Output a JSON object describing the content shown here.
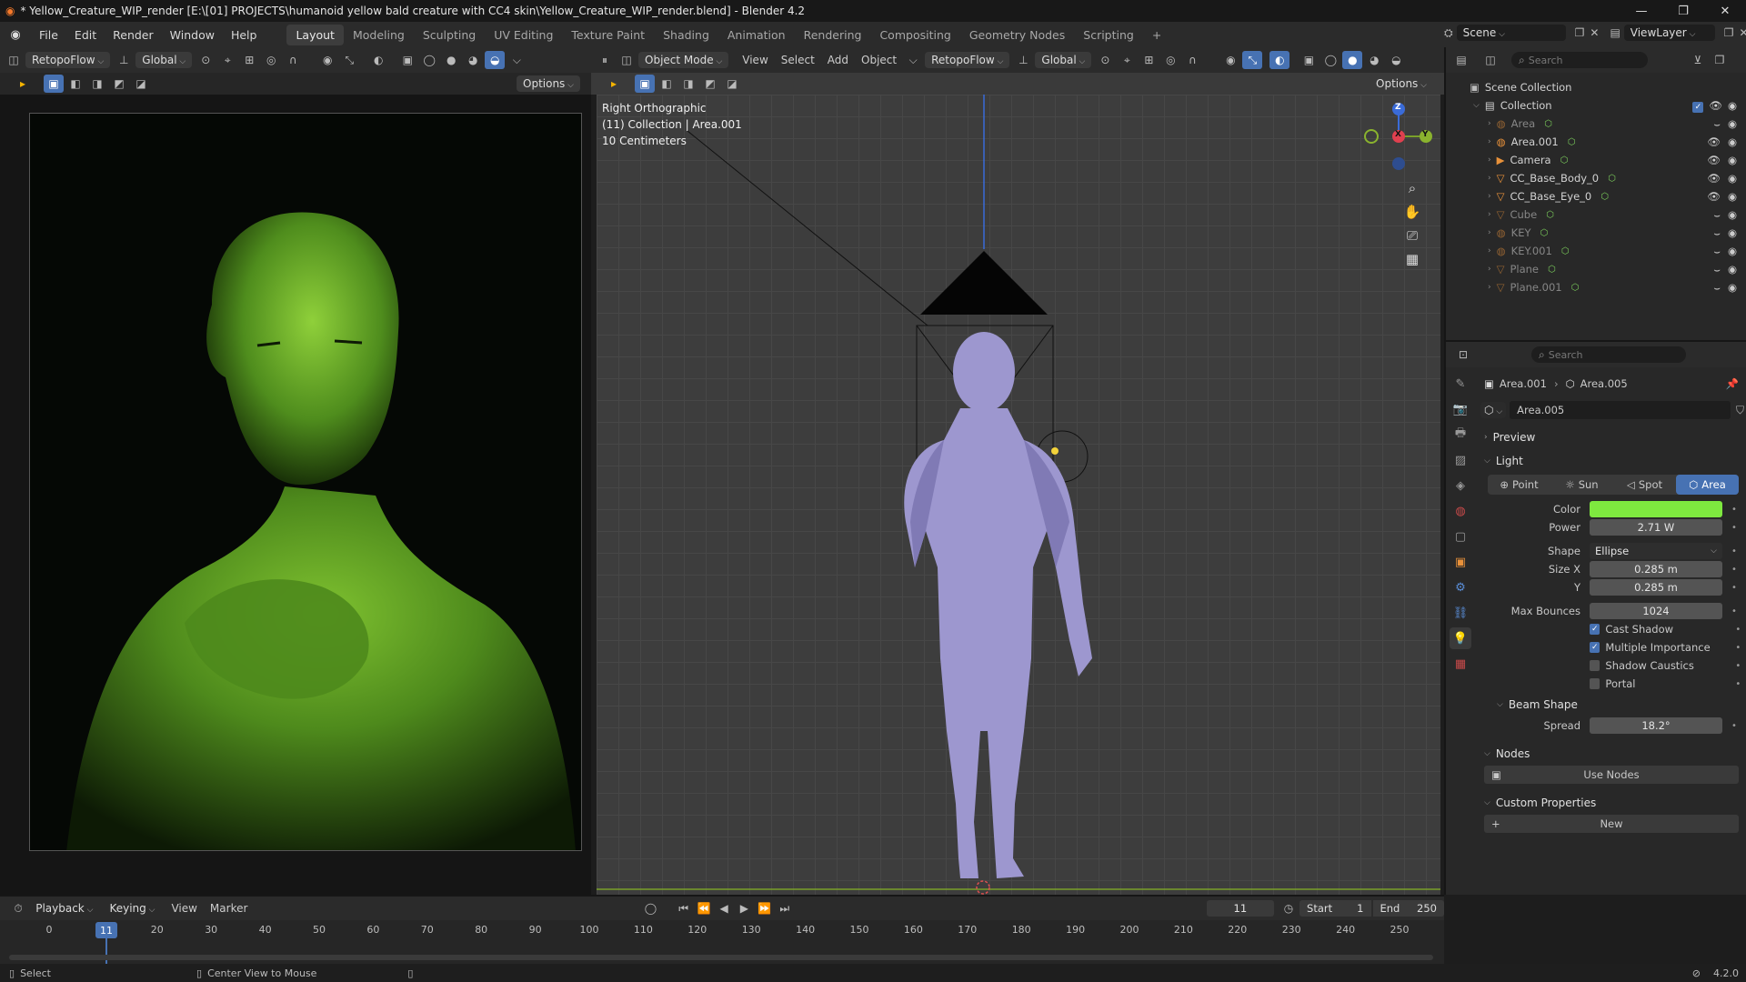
{
  "window": {
    "title": "* Yellow_Creature_WIP_render [E:\\[01] PROJECTS\\humanoid yellow bald creature with CC4 skin\\Yellow_Creature_WIP_render.blend] - Blender 4.2"
  },
  "menu": [
    "File",
    "Edit",
    "Render",
    "Window",
    "Help"
  ],
  "workspaces": [
    "Layout",
    "Modeling",
    "Sculpting",
    "UV Editing",
    "Texture Paint",
    "Shading",
    "Animation",
    "Rendering",
    "Compositing",
    "Geometry Nodes",
    "Scripting"
  ],
  "active_workspace": "Layout",
  "scene_selector": {
    "scene": "Scene",
    "view_layer": "ViewLayer"
  },
  "left_header": {
    "retopoflow": "RetopoFlow",
    "orientation": "Global",
    "options": "Options"
  },
  "viewport_header": {
    "mode": "Object Mode",
    "view": "View",
    "select": "Select",
    "add": "Add",
    "object": "Object",
    "retopoflow": "RetopoFlow",
    "orientation": "Global",
    "options": "Options"
  },
  "viewport_overlay": {
    "view_name": "Right Orthographic",
    "collection": "(11) Collection | Area.001",
    "scale": "10 Centimeters"
  },
  "gizmo": {
    "x": "X",
    "y": "Y",
    "z": "Z"
  },
  "outliner": {
    "search_placeholder": "Search",
    "root": "Scene Collection",
    "collection": "Collection",
    "items": [
      {
        "name": "Area",
        "icon": "light-icon",
        "hidden": true
      },
      {
        "name": "Area.001",
        "icon": "light-icon",
        "hidden": false
      },
      {
        "name": "Camera",
        "icon": "camera-icon",
        "hidden": false
      },
      {
        "name": "CC_Base_Body_0",
        "icon": "mesh-icon",
        "hidden": false
      },
      {
        "name": "CC_Base_Eye_0",
        "icon": "mesh-icon",
        "hidden": false
      },
      {
        "name": "Cube",
        "icon": "mesh-icon",
        "hidden": true
      },
      {
        "name": "KEY",
        "icon": "light-icon",
        "hidden": true
      },
      {
        "name": "KEY.001",
        "icon": "light-icon",
        "hidden": true
      },
      {
        "name": "Plane",
        "icon": "mesh-icon",
        "hidden": true
      },
      {
        "name": "Plane.001",
        "icon": "mesh-icon",
        "hidden": true
      }
    ]
  },
  "properties": {
    "search_placeholder": "Search",
    "breadcrumb_object": "Area.001",
    "breadcrumb_data": "Area.005",
    "datablock": "Area.005",
    "preview_label": "Preview",
    "light_label": "Light",
    "light_types": [
      "Point",
      "Sun",
      "Spot",
      "Area"
    ],
    "active_light_type": "Area",
    "color_label": "Color",
    "color_value": "#7ee83f",
    "power_label": "Power",
    "power": "2.71 W",
    "shape_label": "Shape",
    "shape": "Ellipse",
    "size_x_label": "Size X",
    "size_x": "0.285 m",
    "size_y_label": "Y",
    "size_y": "0.285 m",
    "max_bounces_label": "Max Bounces",
    "max_bounces": "1024",
    "checkboxes": [
      {
        "label": "Cast Shadow",
        "checked": true
      },
      {
        "label": "Multiple Importance",
        "checked": true
      },
      {
        "label": "Shadow Caustics",
        "checked": false
      },
      {
        "label": "Portal",
        "checked": false
      }
    ],
    "beam_shape_label": "Beam Shape",
    "spread_label": "Spread",
    "spread": "18.2°",
    "nodes_label": "Nodes",
    "use_nodes": "Use Nodes",
    "custom_props_label": "Custom Properties",
    "new_label": "New"
  },
  "timeline": {
    "playback": "Playback",
    "keying": "Keying",
    "view": "View",
    "marker": "Marker",
    "current_frame": "11",
    "start_label": "Start",
    "start": "1",
    "end_label": "End",
    "end": "250",
    "ticks": [
      "0",
      "20",
      "30",
      "40",
      "50",
      "60",
      "70",
      "80",
      "90",
      "100",
      "110",
      "120",
      "130",
      "140",
      "150",
      "160",
      "170",
      "180",
      "190",
      "200",
      "210",
      "220",
      "230",
      "240",
      "250"
    ]
  },
  "statusbar": {
    "select": "Select",
    "center_view": "Center View to Mouse",
    "version": "4.2.0"
  }
}
